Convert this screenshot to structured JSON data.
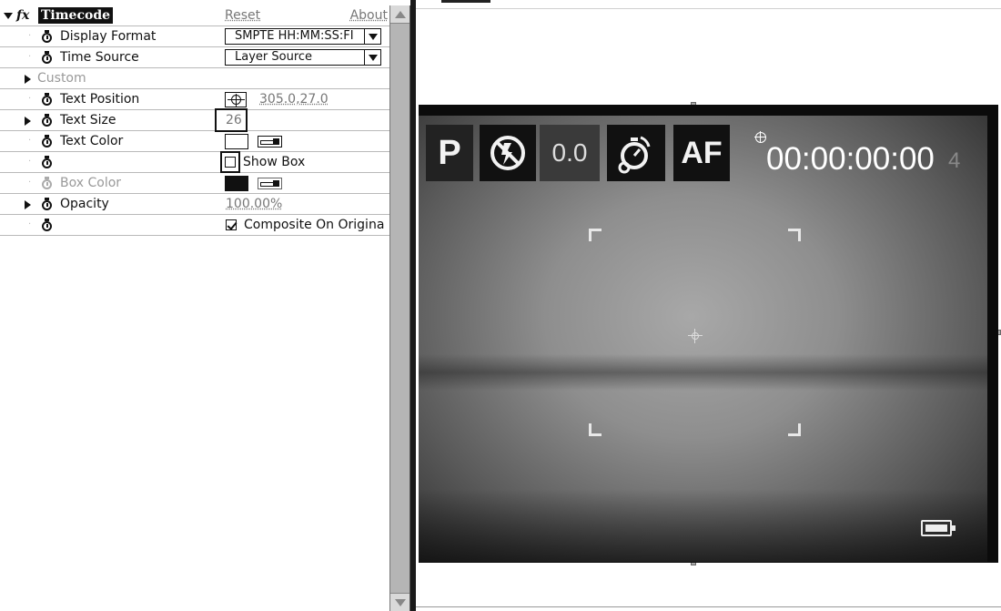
{
  "effect_panel": {
    "effect_name": "Timecode",
    "reset_label": "Reset",
    "about_label": "About",
    "display_format": {
      "label": "Display Format",
      "value": "SMPTE HH:MM:SS:FI"
    },
    "time_source": {
      "label": "Time Source",
      "value": "Layer Source"
    },
    "custom": {
      "label": "Custom"
    },
    "text_position": {
      "label": "Text Position",
      "value": "305.0,27.0"
    },
    "text_size": {
      "label": "Text Size",
      "value": "26"
    },
    "text_color": {
      "label": "Text Color",
      "swatch_color": "#ffffff"
    },
    "show_box": {
      "label": "Show Box",
      "checked": false
    },
    "box_color": {
      "label": "Box Color",
      "swatch_color": "#111111"
    },
    "opacity": {
      "label": "Opacity",
      "value": "100.00%"
    },
    "composite": {
      "label": "Composite On Origina",
      "checked": true
    }
  },
  "viewer": {
    "overlay": {
      "mode": "P",
      "exposure": "0.0",
      "af": "AF",
      "timecode": "00:00:00:00",
      "extra_digit": "4"
    }
  },
  "icons": [
    "stopwatch-icon",
    "fx-icon",
    "position-target-icon",
    "eyedropper-icon",
    "no-flash-icon",
    "self-timer-icon",
    "battery-icon"
  ]
}
